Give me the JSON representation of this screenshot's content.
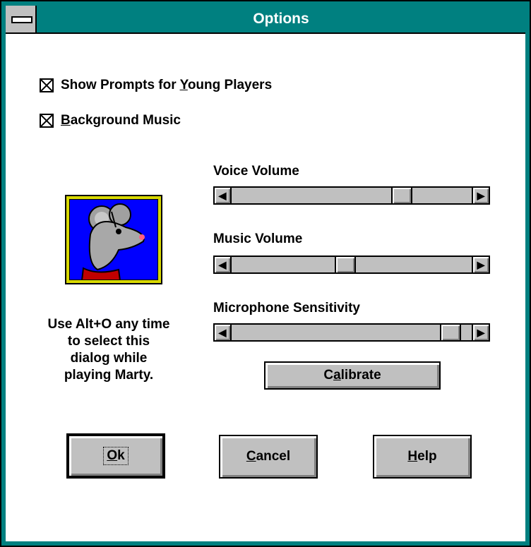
{
  "window": {
    "title": "Options",
    "accent_color": "#008080",
    "face_color": "#c0c0c0"
  },
  "options": {
    "show_prompts": {
      "label_pre": "Show Prompts for ",
      "label_mnemonic": "Y",
      "label_post": "oung Players",
      "checked": true
    },
    "background_music": {
      "label_pre": "",
      "label_mnemonic": "B",
      "label_post": "ackground Music",
      "checked": true
    }
  },
  "sliders": {
    "voice": {
      "label": "Voice Volume",
      "value_fraction": 0.73
    },
    "music": {
      "label": "Music Volume",
      "value_fraction": 0.47
    },
    "mic": {
      "label": "Microphone Sensitivity",
      "value_fraction": 0.95
    }
  },
  "image": {
    "icon": "mouse-character-icon",
    "bg_color": "#0000ff",
    "frame_color": "#d8d800"
  },
  "hint": {
    "lines": [
      "Use Alt+O any time",
      "to select this",
      "dialog while",
      "playing Marty."
    ]
  },
  "buttons": {
    "calibrate": {
      "pre": "C",
      "mnemonic": "a",
      "post": "librate"
    },
    "ok": {
      "pre": "",
      "mnemonic": "O",
      "post": "k"
    },
    "cancel": {
      "pre": "",
      "mnemonic": "C",
      "post": "ancel"
    },
    "help": {
      "pre": "",
      "mnemonic": "H",
      "post": "elp"
    }
  }
}
